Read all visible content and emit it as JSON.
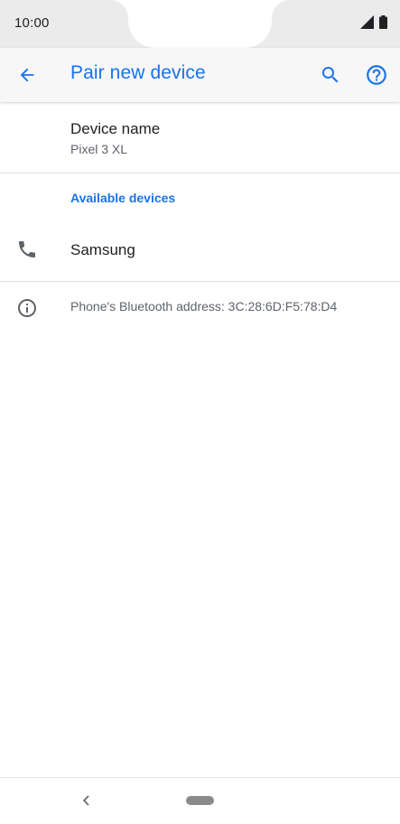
{
  "status_bar": {
    "time": "10:00",
    "icons": [
      "signal-icon",
      "battery-icon"
    ]
  },
  "app_bar": {
    "title": "Pair new device",
    "icons": [
      "back-arrow-icon",
      "search-icon",
      "help-icon"
    ],
    "accent_color": "#1a73e8"
  },
  "device_name": {
    "title": "Device name",
    "value": "Pixel 3 XL"
  },
  "available_devices": {
    "header": "Available devices",
    "items": [
      {
        "label": "Samsung",
        "icon": "phone-icon"
      }
    ]
  },
  "bluetooth_info": {
    "text": "Phone's Bluetooth address: 3C:28:6D:F5:78:D4",
    "icon": "info-icon"
  },
  "nav_bar": {
    "icons": [
      "nav-back-icon",
      "nav-home-pill"
    ]
  }
}
